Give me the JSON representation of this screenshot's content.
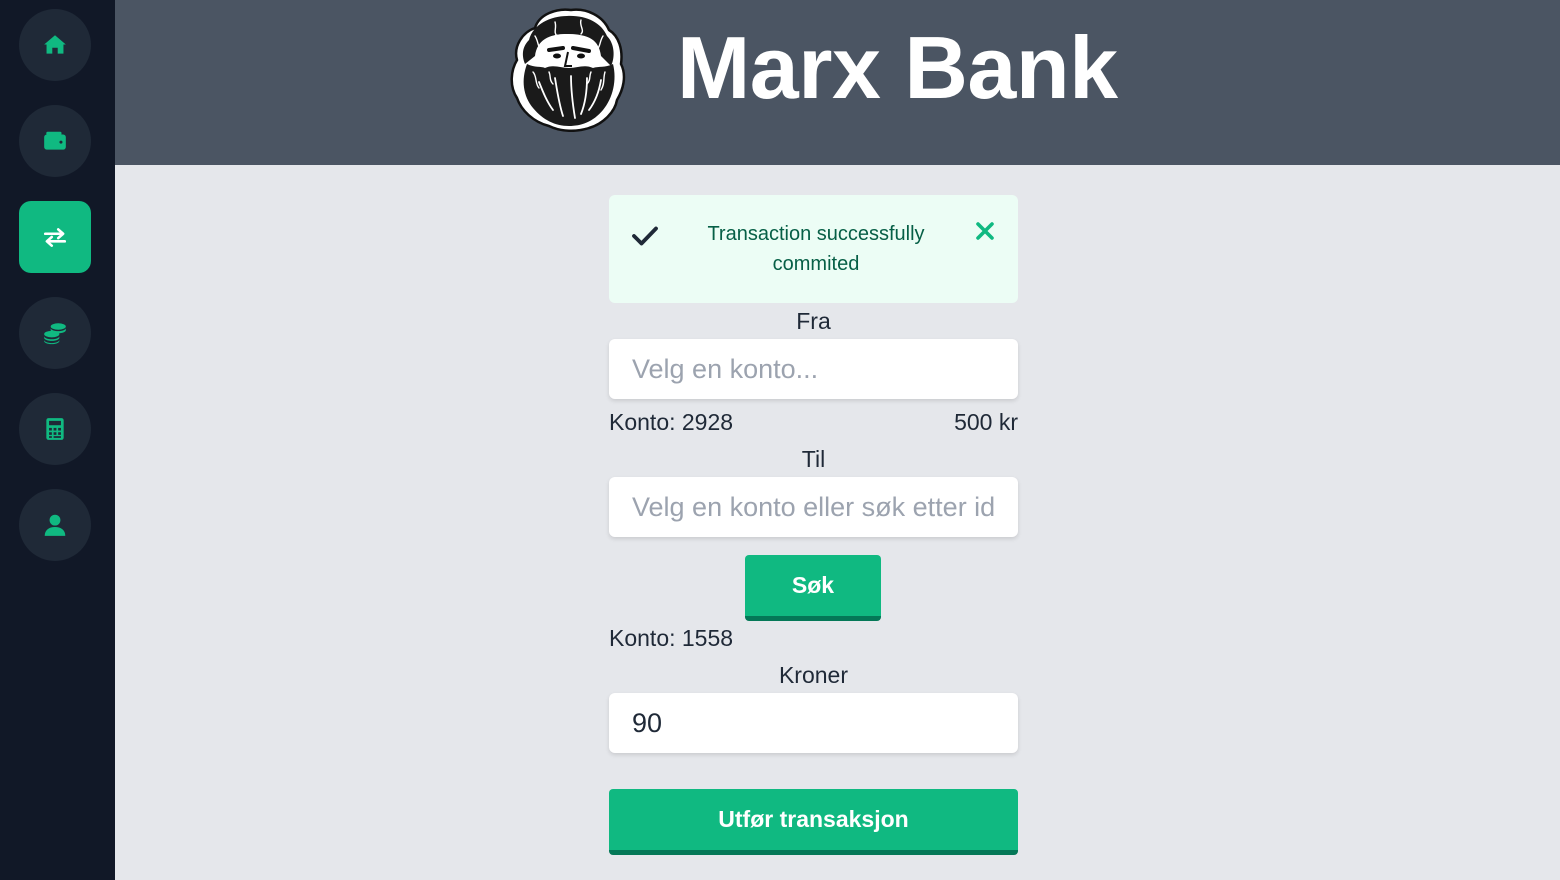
{
  "app": {
    "title": "Marx Bank"
  },
  "sidebar": {
    "items": [
      {
        "icon": "home-icon",
        "active": false
      },
      {
        "icon": "wallet-icon",
        "active": false
      },
      {
        "icon": "transfer-arrows-icon",
        "active": true
      },
      {
        "icon": "coins-icon",
        "active": false
      },
      {
        "icon": "calculator-icon",
        "active": false
      },
      {
        "icon": "user-icon",
        "active": false
      }
    ]
  },
  "alert": {
    "message": "Transaction successfully commited",
    "icon": "check-icon",
    "close_icon": "close-icon"
  },
  "form": {
    "from_label": "Fra",
    "from_placeholder": "Velg en konto...",
    "from_account": "Konto: 2928",
    "from_balance": "500 kr",
    "to_label": "Til",
    "to_placeholder": "Velg en konto eller søk etter id",
    "search_label": "Søk",
    "to_account": "Konto: 1558",
    "amount_label": "Kroner",
    "amount_value": "90",
    "submit_label": "Utfør transaksjon"
  },
  "colors": {
    "accent": "#10b981",
    "accent_dark": "#047857",
    "sidebar_bg": "#111827",
    "header_bg": "#4b5563",
    "page_bg": "#e5e7eb",
    "alert_bg": "#ecfdf5",
    "alert_text": "#065f46"
  }
}
